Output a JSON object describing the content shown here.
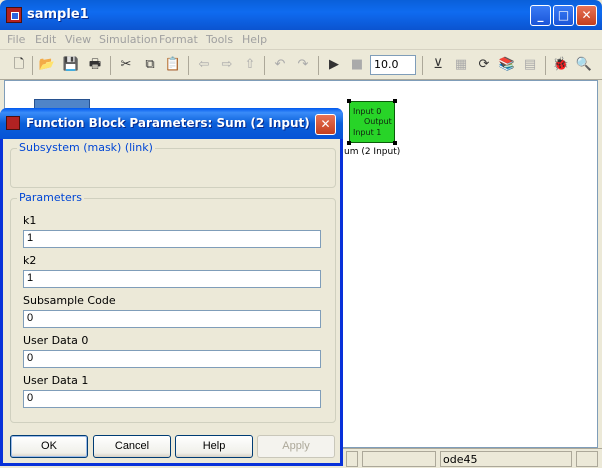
{
  "window": {
    "title": "sample1"
  },
  "menubar": {
    "items": [
      "File",
      "Edit",
      "View",
      "Simulation",
      "Format",
      "Tools",
      "Help"
    ]
  },
  "toolbar": {
    "stop_time": "10.0"
  },
  "model": {
    "sum_block": {
      "ports": [
        "Input 0",
        "Input 1"
      ],
      "output": "Output",
      "caption": "um (2 Input)"
    }
  },
  "statusbar": {
    "solver": "ode45"
  },
  "dialog": {
    "title": "Function Block Parameters: Sum (2 Input)",
    "description_group": "Subsystem (mask) (link)",
    "params_group": "Parameters",
    "fields": [
      {
        "label": "k1",
        "value": "1"
      },
      {
        "label": "k2",
        "value": "1"
      },
      {
        "label": "Subsample Code",
        "value": "0"
      },
      {
        "label": "User Data 0",
        "value": "0"
      },
      {
        "label": "User Data 1",
        "value": "0"
      }
    ],
    "buttons": {
      "ok": "OK",
      "cancel": "Cancel",
      "help": "Help",
      "apply": "Apply"
    }
  }
}
